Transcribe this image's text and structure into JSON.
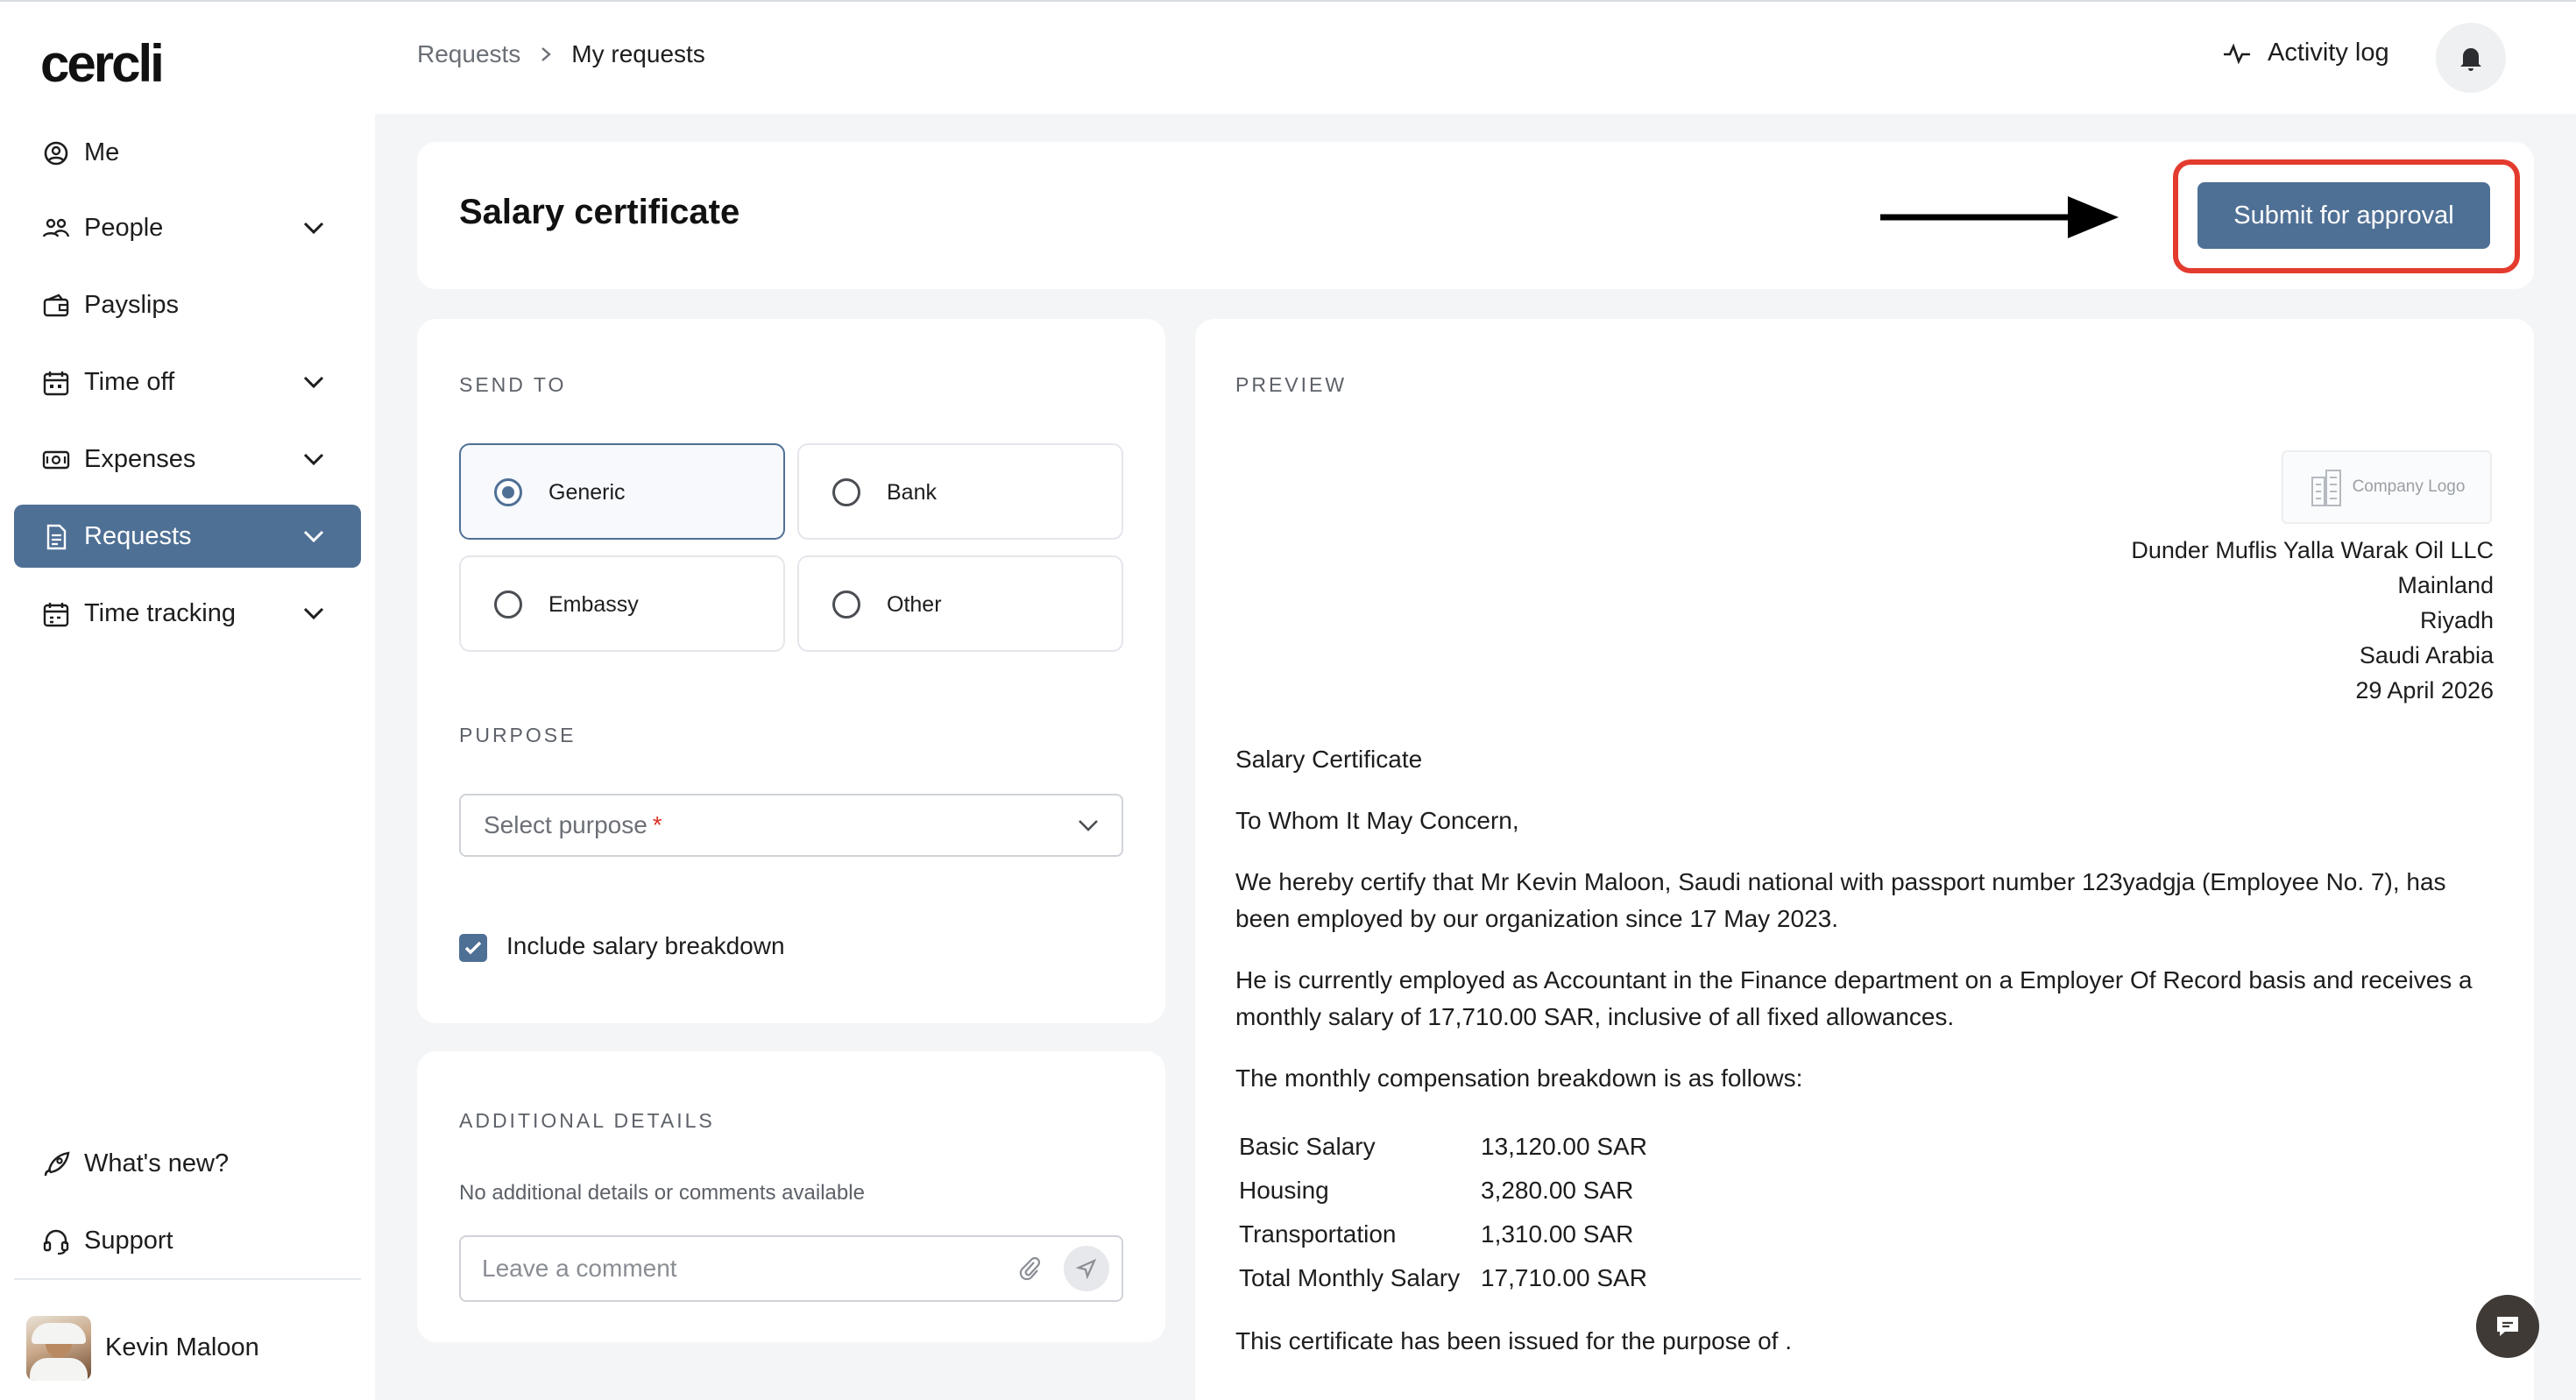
{
  "brand": {
    "logo": "cercli",
    "accent": "#4f7095",
    "highlight": "#e33b2e"
  },
  "sidebar": {
    "items": [
      {
        "label": "Me",
        "icon": "user-circle-icon",
        "expandable": false
      },
      {
        "label": "People",
        "icon": "people-icon",
        "expandable": true
      },
      {
        "label": "Payslips",
        "icon": "wallet-icon",
        "expandable": false
      },
      {
        "label": "Time off",
        "icon": "calendar-icon",
        "expandable": true
      },
      {
        "label": "Expenses",
        "icon": "cash-icon",
        "expandable": true
      },
      {
        "label": "Requests",
        "icon": "document-icon",
        "expandable": true,
        "active": true
      },
      {
        "label": "Time tracking",
        "icon": "calendar-clock-icon",
        "expandable": true
      }
    ],
    "footer": [
      {
        "label": "What's new?",
        "icon": "rocket-icon"
      },
      {
        "label": "Support",
        "icon": "headset-icon"
      }
    ],
    "user": {
      "name": "Kevin Maloon"
    }
  },
  "topbar": {
    "breadcrumb": [
      "Requests",
      "My requests"
    ],
    "activity_log": "Activity log"
  },
  "header": {
    "title": "Salary certificate",
    "submit_label": "Submit for approval"
  },
  "form": {
    "send_to_label": "SEND TO",
    "send_to_options": [
      {
        "label": "Generic",
        "selected": true
      },
      {
        "label": "Bank",
        "selected": false
      },
      {
        "label": "Embassy",
        "selected": false
      },
      {
        "label": "Other",
        "selected": false
      }
    ],
    "purpose_label": "PURPOSE",
    "purpose_placeholder": "Select purpose",
    "purpose_required": "*",
    "include_breakdown_label": "Include salary breakdown",
    "include_breakdown": true
  },
  "additional": {
    "label": "ADDITIONAL DETAILS",
    "empty_text": "No additional details or comments available",
    "comment_placeholder": "Leave a comment"
  },
  "preview": {
    "label": "PREVIEW",
    "company_logo_text": "Company Logo",
    "address": [
      "Dunder Muflis Yalla Warak Oil LLC",
      "Mainland",
      "Riyadh",
      "Saudi Arabia",
      "29 April 2026"
    ],
    "heading": "Salary Certificate",
    "salutation": "To Whom It May Concern,",
    "para1": "We hereby certify that Mr Kevin Maloon, Saudi national with passport number 123yadgja (Employee No. 7), has been employed by our organization since 17 May 2023.",
    "para2": "He is currently employed as Accountant in the Finance department on a Employer Of Record basis and receives a monthly salary of 17,710.00 SAR, inclusive of all fixed allowances.",
    "para3": "The monthly compensation breakdown is as follows:",
    "breakdown": [
      {
        "label": "Basic Salary",
        "value": "13,120.00 SAR"
      },
      {
        "label": "Housing",
        "value": "3,280.00 SAR"
      },
      {
        "label": "Transportation",
        "value": "1,310.00 SAR"
      },
      {
        "label": "Total Monthly Salary",
        "value": "17,710.00 SAR"
      }
    ],
    "para4": "This certificate has been issued for the purpose of ."
  }
}
